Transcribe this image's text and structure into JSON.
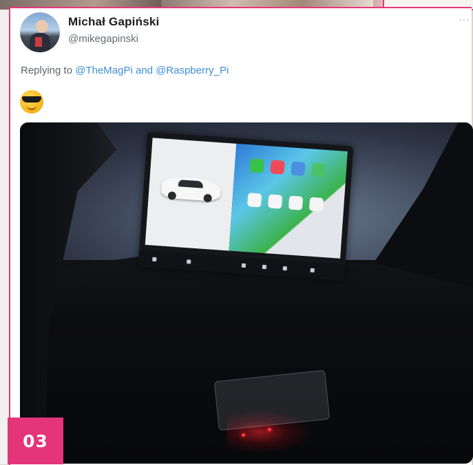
{
  "tweet": {
    "display_name": "Michał Gapiński",
    "handle": "@mikegapinski",
    "reply_prefix": "Replying to",
    "mention_1": "@TheMagPi",
    "reply_conjunction": "and",
    "mention_2": "@Raspberry_Pi",
    "emoji": "sunglasses-emoji",
    "more_icon": "more-options-icon"
  },
  "figure": {
    "badge_label": "03"
  },
  "colors": {
    "accent_pink": "#e4347a",
    "mention_blue": "#3d8fd8",
    "handle_gray": "#666b70"
  }
}
